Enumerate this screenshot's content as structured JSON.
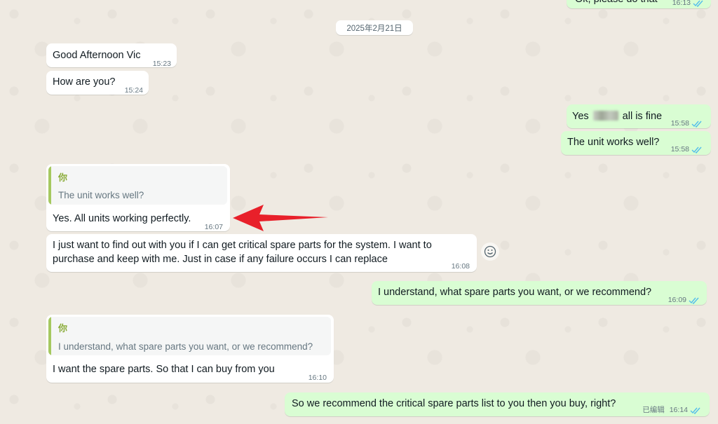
{
  "date_chip": "2025年2月21日",
  "top_partial": {
    "text": "Ok, please do that",
    "time": "16:13"
  },
  "messages": [
    {
      "text": "Good Afternoon Vic",
      "time": "15:23"
    },
    {
      "text": "How are you?",
      "time": "15:24"
    },
    {
      "text_before": "Yes",
      "text_after": "all is fine",
      "time": "15:58"
    },
    {
      "text": "The unit works well?",
      "time": "15:58"
    },
    {
      "quote_author": "你",
      "quote_text": "The unit works well?",
      "text": "Yes. All units working perfectly.",
      "time": "16:07"
    },
    {
      "line1": "I just want to find out with you if I can get critical spare parts for the system. I want to",
      "line2": "purchase and keep with me. Just in case if any failure occurs I can replace",
      "time": "16:08"
    },
    {
      "text": "I understand, what spare parts you want, or we recommend?",
      "time": "16:09"
    },
    {
      "quote_author": "你",
      "quote_text": "I understand, what spare parts you want, or we recommend?",
      "text": "I want the spare parts. So that I can buy from you",
      "time": "16:10"
    },
    {
      "text": "So we recommend the critical spare parts list to you then you buy, right?",
      "edited": "已编辑",
      "time": "16:14"
    }
  ],
  "icons": {
    "read_ticks": "double-check-icon",
    "react": "emoji-react-icon"
  },
  "colors": {
    "background": "#efeae2",
    "incoming": "#ffffff",
    "outgoing": "#d9fdd3",
    "tick_blue": "#53bdeb",
    "quote_bar": "#a5c85f",
    "arrow": "#e8202a"
  }
}
